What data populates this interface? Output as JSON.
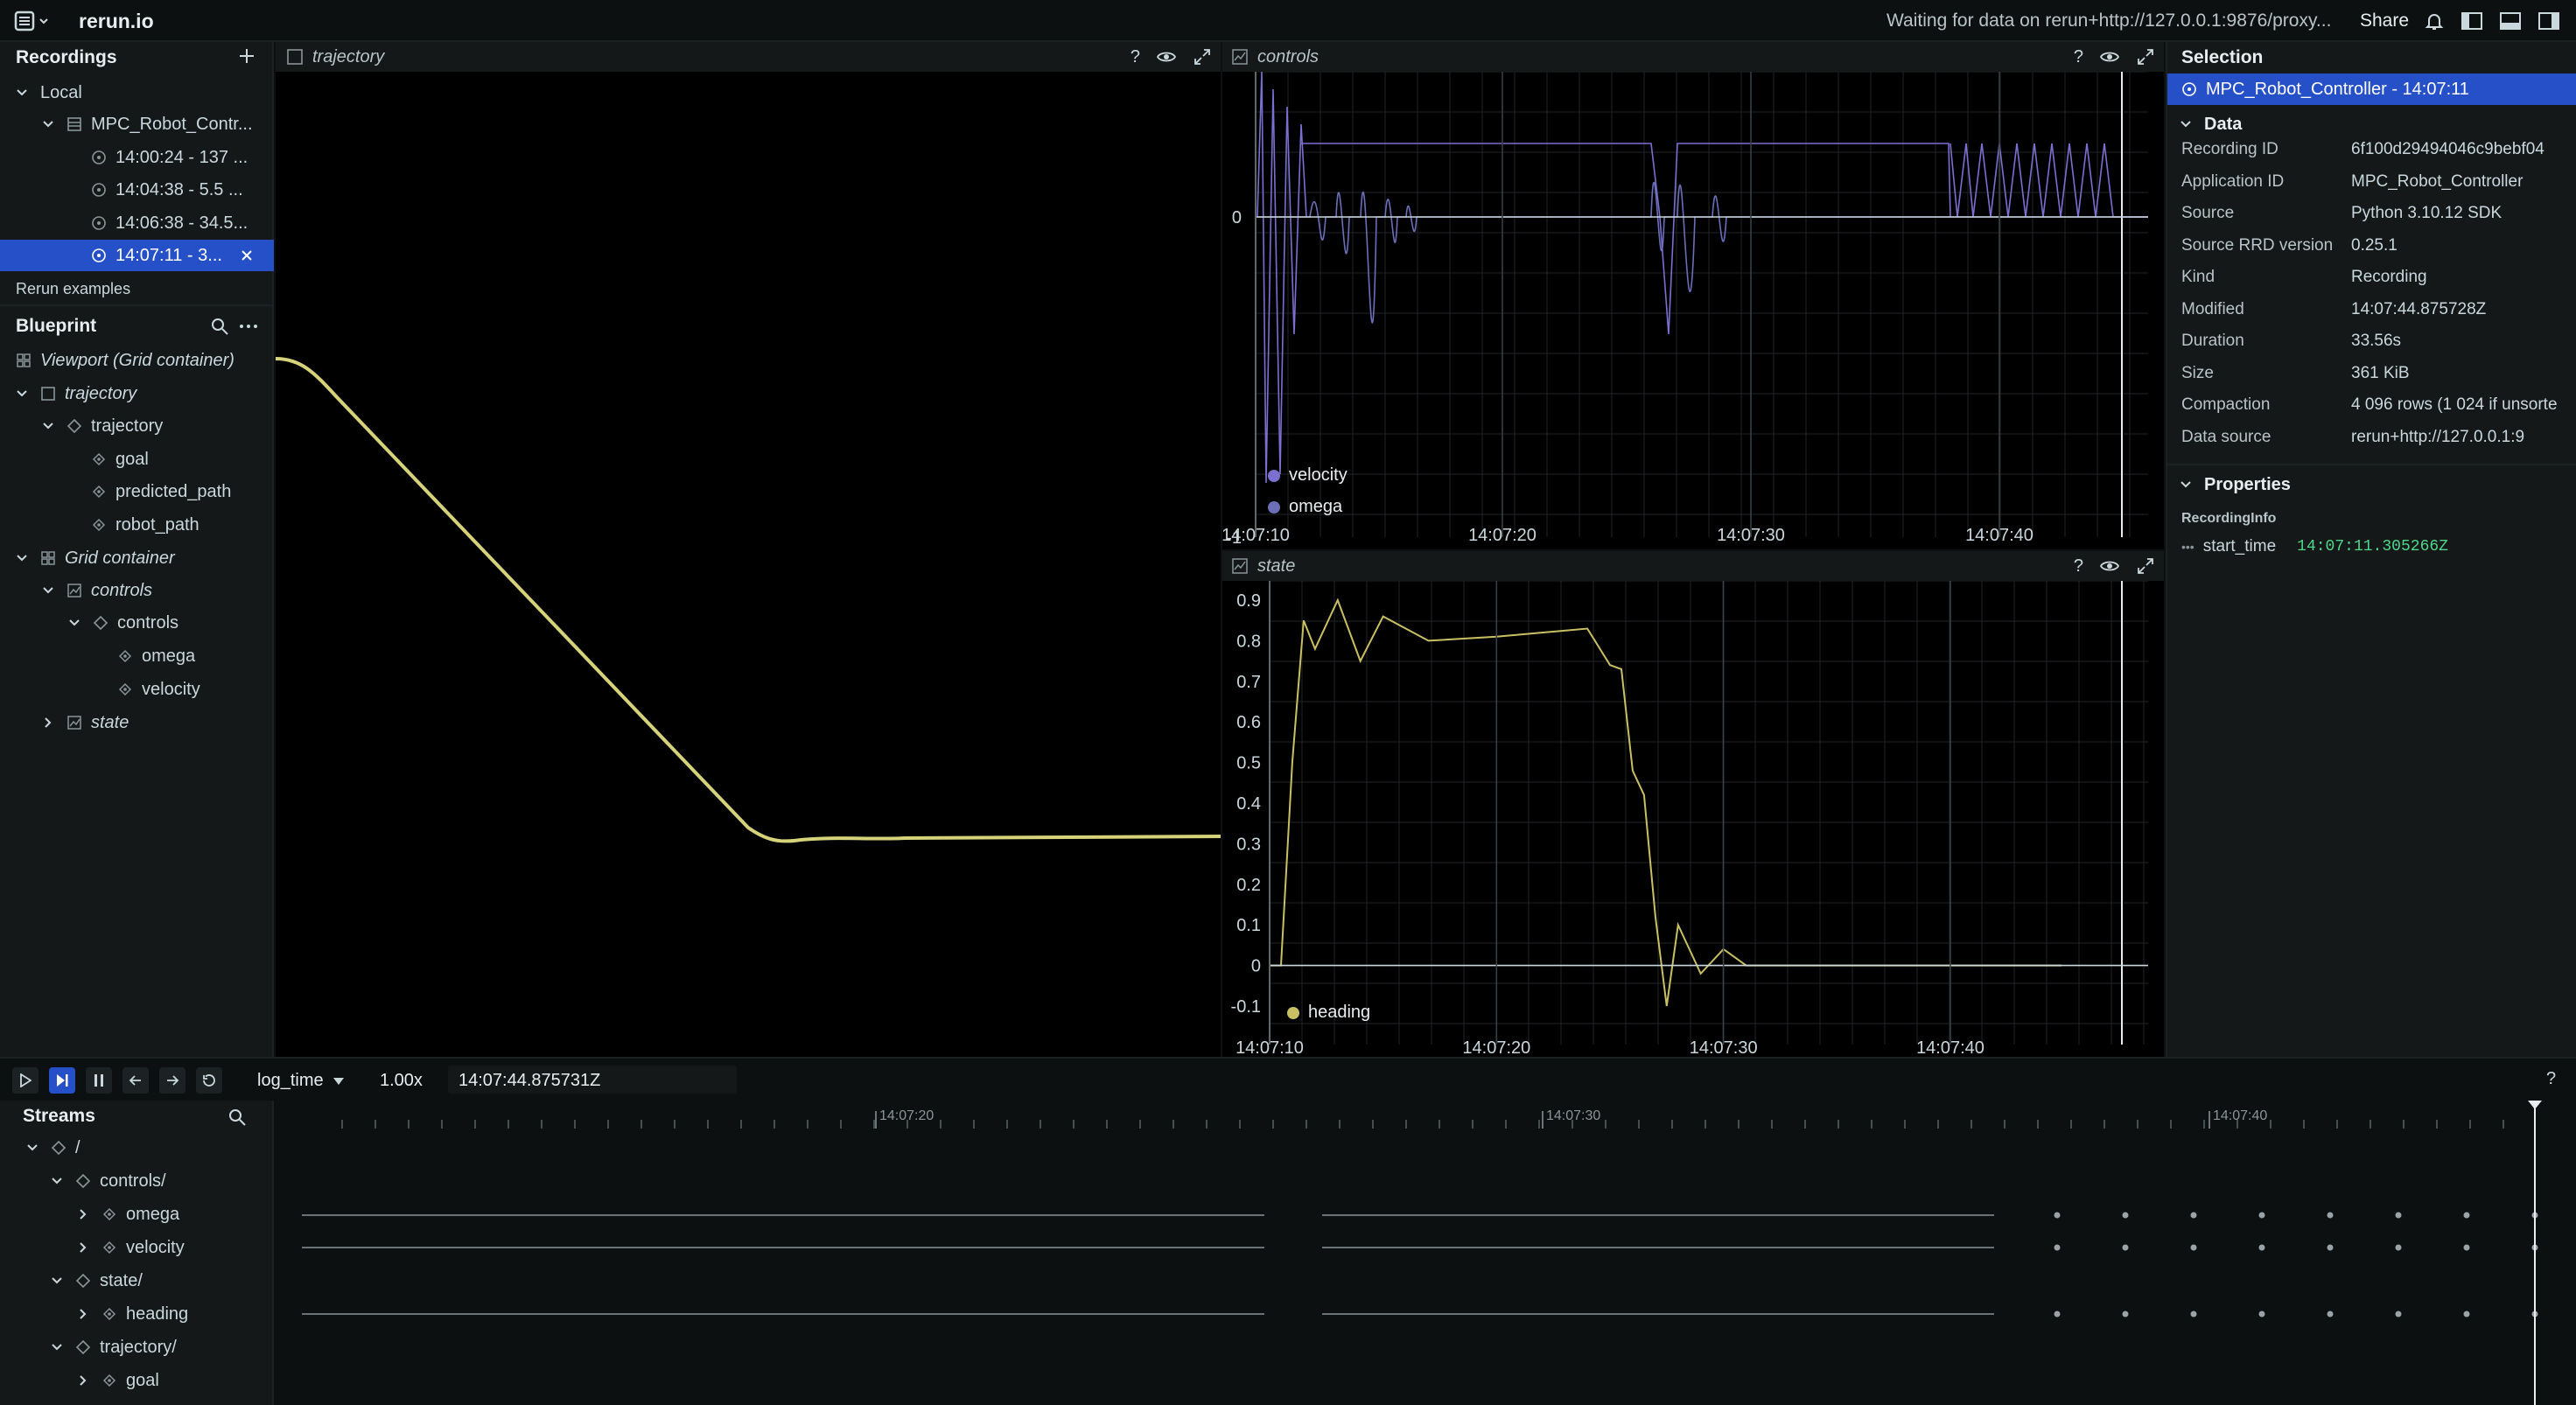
{
  "topbar": {
    "app_name": "rerun.io",
    "status": "Waiting for data on rerun+http://127.0.0.1:9876/proxy...",
    "share": "Share",
    "icons": [
      "rerun-logo-icon",
      "bell-icon",
      "left-panel-icon",
      "bottom-panel-icon",
      "right-panel-icon"
    ]
  },
  "recordings": {
    "title": "Recordings",
    "local": "Local",
    "app": "MPC_Robot_Contr...",
    "items": [
      "14:00:24 - 137 ...",
      "14:04:38 - 5.5 ...",
      "14:06:38 - 34.5...",
      "14:07:11 - 3..."
    ],
    "examples": "Rerun examples"
  },
  "blueprint": {
    "title": "Blueprint",
    "viewport": "Viewport (Grid container)",
    "trajectory_view": "trajectory",
    "trajectory_entity": "trajectory",
    "goal": "goal",
    "predicted_path": "predicted_path",
    "robot_path": "robot_path",
    "grid": "Grid container",
    "controls_view": "controls",
    "controls_entity": "controls",
    "omega": "omega",
    "velocity": "velocity",
    "state_view": "state"
  },
  "views": {
    "trajectory": "trajectory",
    "controls": "controls",
    "state": "state"
  },
  "chart_data": [
    {
      "type": "line",
      "view": "controls",
      "x_ticks": [
        "14:07:10",
        "14:07:20",
        "14:07:30",
        "14:07:40"
      ],
      "y_ticks": [
        "0",
        "-1"
      ],
      "series": [
        {
          "name": "velocity",
          "color": "#7b6fd0"
        },
        {
          "name": "omega",
          "color": "#6a6fb8"
        }
      ]
    },
    {
      "type": "line",
      "view": "state",
      "x_ticks": [
        "14:07:10",
        "14:07:20",
        "14:07:30",
        "14:07:40"
      ],
      "y_ticks": [
        "0.9",
        "0.8",
        "0.7",
        "0.6",
        "0.5",
        "0.4",
        "0.3",
        "0.2",
        "0.1",
        "0",
        "-0.1"
      ],
      "ylim": [
        -0.1,
        0.9
      ],
      "series": [
        {
          "name": "heading",
          "color": "#c9c064",
          "x": [
            10.0,
            10.5,
            11,
            11.5,
            12,
            13,
            14,
            15,
            17,
            20,
            24,
            25,
            25.5,
            26,
            26.5,
            27,
            27.5,
            28,
            29,
            30,
            31,
            32,
            35,
            40,
            44.9
          ],
          "y": [
            0,
            0,
            0.5,
            0.85,
            0.78,
            0.9,
            0.75,
            0.86,
            0.8,
            0.81,
            0.83,
            0.74,
            0.73,
            0.48,
            0.42,
            0.12,
            -0.1,
            0.1,
            -0.02,
            0.04,
            0,
            0,
            0,
            0,
            0
          ]
        }
      ]
    }
  ],
  "selection": {
    "title": "Selection",
    "selected": "MPC_Robot_Controller - 14:07:11",
    "data_header": "Data",
    "fields": [
      {
        "k": "Recording ID",
        "v": "6f100d29494046c9bebf04"
      },
      {
        "k": "Application ID",
        "v": "MPC_Robot_Controller"
      },
      {
        "k": "Source",
        "v": "Python 3.10.12 SDK"
      },
      {
        "k": "Source RRD version",
        "v": "0.25.1"
      },
      {
        "k": "Kind",
        "v": "Recording"
      },
      {
        "k": "Modified",
        "v": "14:07:44.875728Z"
      },
      {
        "k": "Duration",
        "v": "33.56s"
      },
      {
        "k": "Size",
        "v": "361 KiB"
      },
      {
        "k": "Compaction",
        "v": "4 096 rows (1 024 if unsorte"
      },
      {
        "k": "Data source",
        "v": "rerun+http://127.0.0.1:9"
      }
    ],
    "properties_header": "Properties",
    "recording_info": "RecordingInfo",
    "start_time_key": "start_time",
    "start_time_val": "14:07:11.305266Z"
  },
  "time_controls": {
    "timeline": "log_time",
    "speed": "1.00x",
    "current": "14:07:44.875731Z",
    "help": "?"
  },
  "streams": {
    "title": "Streams",
    "root": "/",
    "controls": "controls/",
    "omega": "omega",
    "velocity": "velocity",
    "state": "state/",
    "heading": "heading",
    "trajectory": "trajectory/",
    "goal": "goal",
    "ticks": [
      "14:07:20",
      "14:07:30",
      "14:07:40"
    ]
  }
}
